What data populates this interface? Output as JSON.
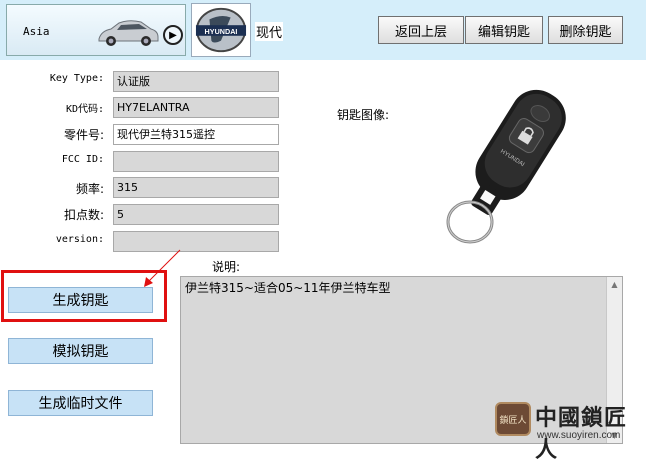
{
  "header": {
    "region": "Asia",
    "brand_logo_text": "HYUNDAI",
    "brand_name": "现代",
    "buttons": {
      "back": "返回上层",
      "edit_key": "编辑钥匙",
      "delete_key": "删除钥匙"
    }
  },
  "form": {
    "key_type": {
      "label": "Key Type:",
      "value": "认证版"
    },
    "kd_code": {
      "label": "KD代码:",
      "value": "HY7ELANTRA"
    },
    "part_no": {
      "label": "零件号:",
      "value": "现代伊兰特315遥控"
    },
    "fcc_id": {
      "label": "FCC ID:",
      "value": ""
    },
    "frequency": {
      "label": "频率:",
      "value": "315"
    },
    "pin_count": {
      "label": "扣点数:",
      "value": "5"
    },
    "version": {
      "label": "version:",
      "value": ""
    }
  },
  "key_image_label": "钥匙图像:",
  "key_image_brand": "HYUNDAI",
  "description": {
    "label": "说明:",
    "text": "伊兰特315~适合05~11年伊兰特车型"
  },
  "actions": {
    "generate_key": "生成钥匙",
    "simulate_key": "模拟钥匙",
    "generate_temp_file": "生成临时文件"
  },
  "watermark": {
    "icon_text": "鎖匠人",
    "title": "中國鎖匠人",
    "url": "www.suoyiren.com"
  },
  "colors": {
    "header_bg": "#d5eefa",
    "field_bg": "#d8d8d8",
    "action_button_bg": "#c7e2f6",
    "highlight_red": "#e01010"
  }
}
